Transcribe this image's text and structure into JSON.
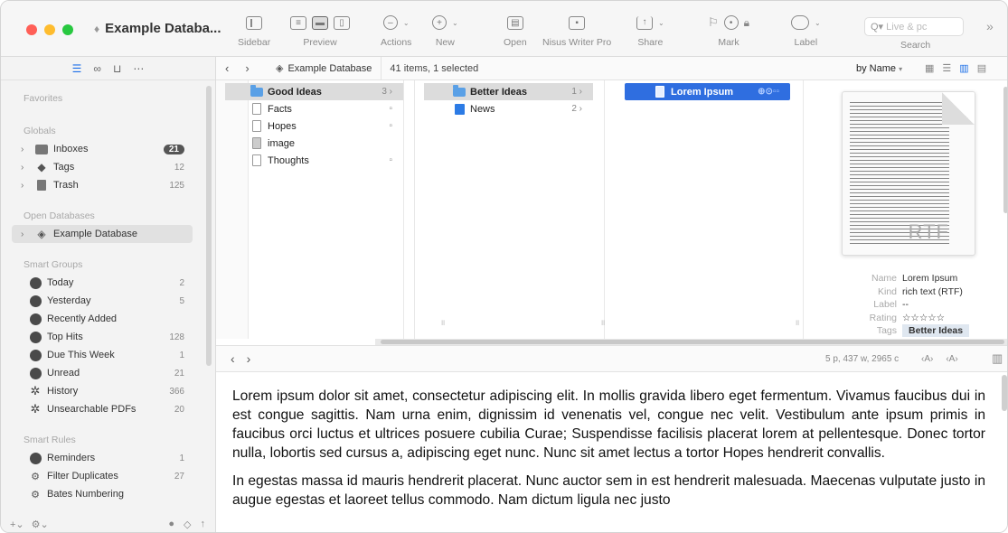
{
  "window": {
    "title": "Example Databa...",
    "traffic_lights": [
      "#ff5f57",
      "#febc2e",
      "#28c840"
    ]
  },
  "toolbar": {
    "items": [
      {
        "label": "Sidebar"
      },
      {
        "label": "Preview"
      },
      {
        "label": "Actions"
      },
      {
        "label": "New"
      },
      {
        "label": "Open"
      },
      {
        "label": "Nisus Writer Pro"
      },
      {
        "label": "Share"
      },
      {
        "label": "Mark"
      },
      {
        "label": "Label"
      }
    ],
    "search_placeholder": "Live & pc",
    "search_label": "Search",
    "more": "»"
  },
  "sidebar": {
    "favorites_header": "Favorites",
    "globals_header": "Globals",
    "globals": [
      {
        "label": "Inboxes",
        "count": "21",
        "icon": "inbox-icon"
      },
      {
        "label": "Tags",
        "count": "12",
        "icon": "tag-icon"
      },
      {
        "label": "Trash",
        "count": "125",
        "icon": "trash-icon"
      }
    ],
    "open_db_header": "Open Databases",
    "open_dbs": [
      {
        "label": "Example Database"
      }
    ],
    "smart_groups_header": "Smart Groups",
    "smart_groups": [
      {
        "label": "Today",
        "count": "2"
      },
      {
        "label": "Yesterday",
        "count": "5"
      },
      {
        "label": "Recently Added",
        "count": ""
      },
      {
        "label": "Top Hits",
        "count": "128"
      },
      {
        "label": "Due This Week",
        "count": "1"
      },
      {
        "label": "Unread",
        "count": "21"
      },
      {
        "label": "History",
        "count": "366"
      },
      {
        "label": "Unsearchable PDFs",
        "count": "20"
      }
    ],
    "smart_rules_header": "Smart Rules",
    "smart_rules": [
      {
        "label": "Reminders",
        "count": "1"
      },
      {
        "label": "Filter Duplicates",
        "count": "27"
      },
      {
        "label": "Bates Numbering",
        "count": ""
      }
    ]
  },
  "pathbar": {
    "crumb": "Example Database",
    "info": "41 items, 1 selected",
    "sort": "by Name"
  },
  "columns": {
    "col1": [
      {
        "label": "Good Ideas",
        "count": "3"
      },
      {
        "label": "Facts",
        "count": ""
      },
      {
        "label": "Hopes",
        "count": ""
      },
      {
        "label": "image",
        "count": ""
      },
      {
        "label": "Thoughts",
        "count": ""
      }
    ],
    "col2": [
      {
        "label": "Better Ideas",
        "count": "1"
      },
      {
        "label": "News",
        "count": "2"
      }
    ],
    "col3": [
      {
        "label": "Lorem Ipsum"
      }
    ]
  },
  "inspector": {
    "thumb_label": "RTF",
    "name_key": "Name",
    "name_val": "Lorem Ipsum",
    "kind_key": "Kind",
    "kind_val": "rich text (RTF)",
    "label_key": "Label",
    "label_val": "--",
    "rating_key": "Rating",
    "rating_val": "☆☆☆☆☆",
    "tags_key": "Tags",
    "tags_val": "Better Ideas"
  },
  "editor": {
    "stats": "5 p, 437 w, 2965 c",
    "font_down": "‹A›",
    "font_up": "‹A›",
    "paragraphs": [
      "Lorem ipsum dolor sit amet, consectetur adipiscing elit. In mollis gravida libero eget fermentum. Vivamus faucibus dui in est congue sagittis. Nam urna enim, dignissim id venenatis vel, congue nec velit. Vestibulum ante ipsum primis in faucibus orci luctus et ultrices posuere cubilia Curae; Suspendisse facilisis placerat lorem at pellentesque. Donec tortor nulla, lobortis sed cursus a, adipiscing eget nunc. Nunc sit amet lectus a tortor Hopes hendrerit convallis.",
      "In egestas massa id mauris hendrerit placerat. Nunc auctor sem in est hendrerit malesuada. Maecenas vulputate justo in augue egestas et laoreet tellus commodo. Nam dictum ligula nec justo"
    ]
  }
}
